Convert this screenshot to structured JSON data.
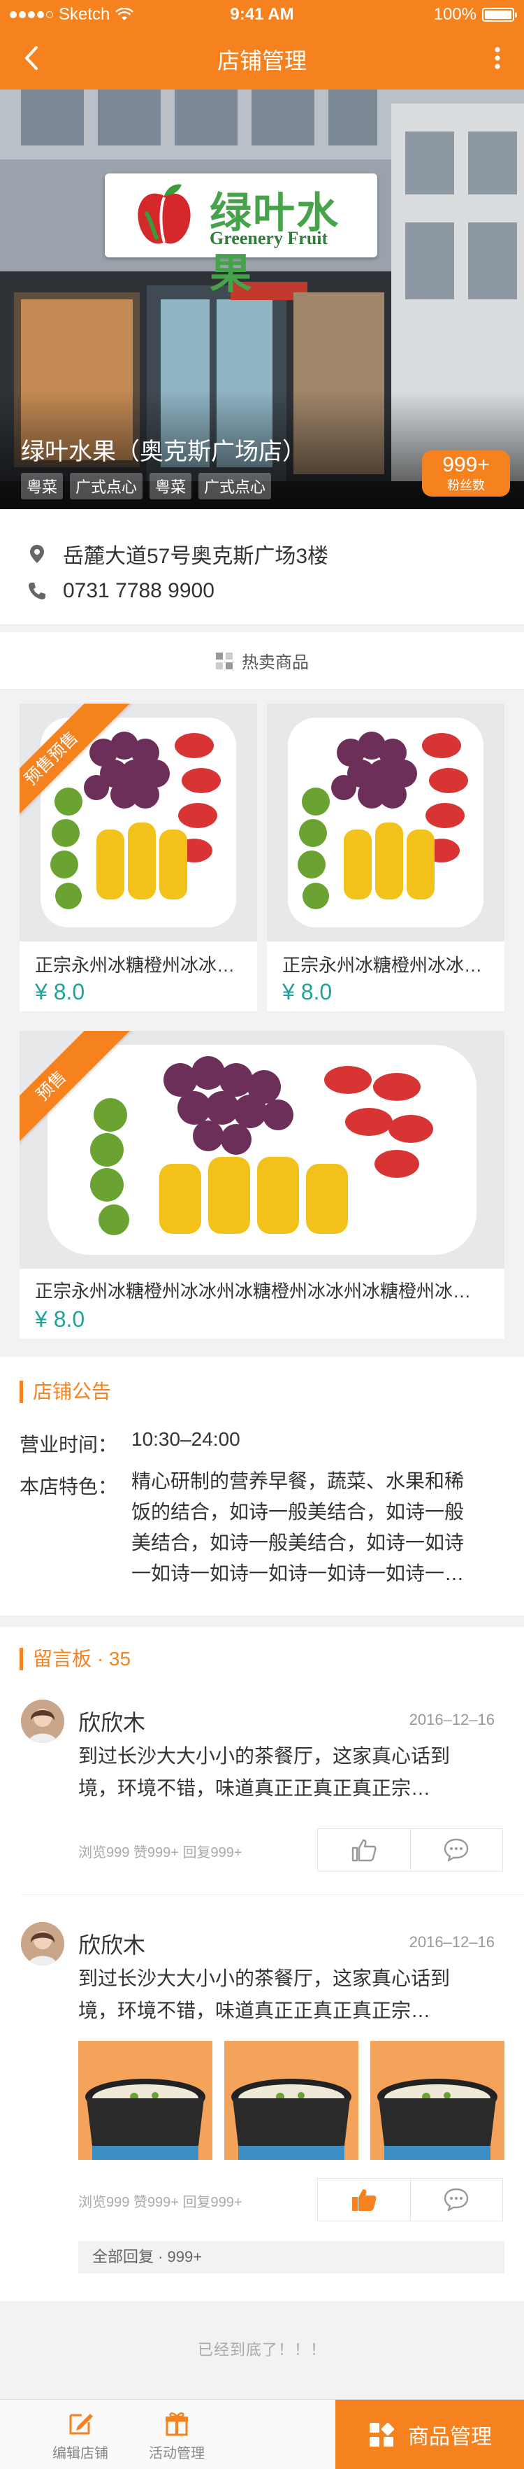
{
  "status_bar": {
    "carrier": "Sketch",
    "time": "9:41 AM",
    "battery": "100%"
  },
  "nav": {
    "title": "店铺管理",
    "back_icon": "back-arrow-icon",
    "more_icon": "more-vertical-icon"
  },
  "store": {
    "sign_cn": "绿叶水果",
    "sign_en": "Greenery Fruit",
    "name": "绿叶水果（奥克斯广场店）",
    "tags": [
      "粤菜",
      "广式点心",
      "粤菜",
      "广式点心"
    ],
    "fans_count": "999+",
    "fans_label": "粉丝数",
    "address": "岳麓大道57号奥克斯广场3楼",
    "phone": "0731 7788 9900"
  },
  "hot_section": {
    "label": "热卖商品"
  },
  "products": [
    {
      "badge": "预售预售",
      "name": "正宗永州冰糖橙州冰冰州冰糖橙州冰冰州冰糖橙",
      "price": "¥ 8.0"
    },
    {
      "badge": "",
      "name": "正宗永州冰糖橙州冰冰州冰糖橙州冰冰州冰糖橙",
      "price": "¥ 8.0"
    },
    {
      "badge": "预售",
      "name": "正宗永州冰糖橙州冰冰州冰糖橙州冰冰州冰糖橙州冰冰州冰糖橙州冰冰",
      "price": "¥ 8.0"
    }
  ],
  "notice": {
    "title": "店铺公告",
    "hours_label": "营业时间：",
    "hours_value": "10:30–24:00",
    "feature_label": "本店特色：",
    "feature_lines": [
      "精心研制的营养早餐，蔬菜、水果和稀",
      "饭的结合，如诗一般美结合，如诗一般",
      "美结合，如诗一般美结合，如诗一如诗",
      "一如诗一如诗一如诗一如诗一如诗一…"
    ]
  },
  "message_board": {
    "title": "留言板 · 35",
    "comments": [
      {
        "name": "欣欣木",
        "date": "2016–12–16",
        "text_lines": [
          "到过长沙大大小小的茶餐厅，这家真心话到",
          "境，环境不错，味道真正正真正真正宗…"
        ],
        "stats": "浏览999  赞999+  回复999+",
        "liked": false
      },
      {
        "name": "欣欣木",
        "date": "2016–12–16",
        "text_lines": [
          "到过长沙大大小小的茶餐厅，这家真心话到",
          "境，环境不错，味道真正正真正真正宗…"
        ],
        "stats": "浏览999  赞999+  回复999+",
        "liked": true,
        "all_replies": "全部回复 · 999+"
      }
    ]
  },
  "end_message": "已经到底了！！！",
  "tabbar": {
    "edit_store": "编辑店铺",
    "activity": "活动管理",
    "goods": "商品管理"
  },
  "colors": {
    "accent": "#f5821f",
    "price": "#1fa39a"
  }
}
